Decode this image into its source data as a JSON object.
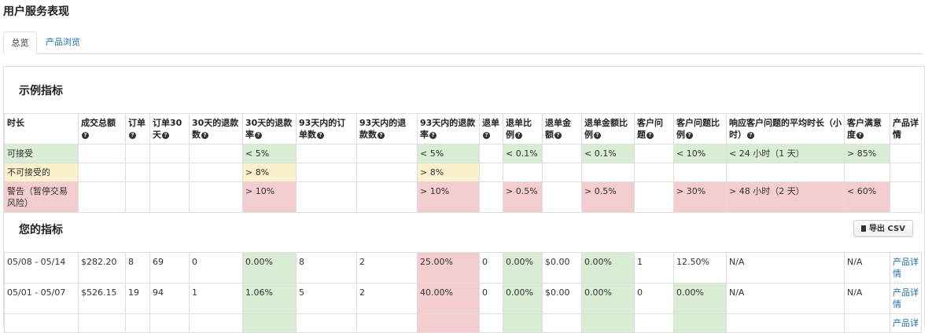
{
  "page_title": "用户服务表现",
  "tabs": [
    {
      "label": "总览",
      "active": true
    },
    {
      "label": "产品浏览",
      "active": false
    }
  ],
  "example_section": {
    "title": "示例指标",
    "columns": [
      {
        "label": "时长",
        "help": false
      },
      {
        "label": "成交总额",
        "help": true
      },
      {
        "label": "订单",
        "help": true
      },
      {
        "label": "订单30天",
        "help": true
      },
      {
        "label": "30天的退款数",
        "help": true
      },
      {
        "label": "30天的退款率",
        "help": true
      },
      {
        "label": "93天内的订单数",
        "help": true
      },
      {
        "label": "93天内的退款数",
        "help": true
      },
      {
        "label": "93天内的退款率",
        "help": true
      },
      {
        "label": "退单",
        "help": true
      },
      {
        "label": "退单比例",
        "help": true
      },
      {
        "label": "退单金额",
        "help": true
      },
      {
        "label": "退单金额比例",
        "help": true
      },
      {
        "label": "客户问题",
        "help": true
      },
      {
        "label": "客户问题比例",
        "help": true
      },
      {
        "label": "响应客户问题的平均时长（小时）",
        "help": true
      },
      {
        "label": "客户满意度",
        "help": true
      },
      {
        "label": "产品详情",
        "help": false
      }
    ],
    "rows": [
      {
        "cells": [
          {
            "t": "可接受",
            "c": "g"
          },
          {
            "t": "",
            "c": ""
          },
          {
            "t": "",
            "c": ""
          },
          {
            "t": "",
            "c": ""
          },
          {
            "t": "",
            "c": ""
          },
          {
            "t": "< 5%",
            "c": "g"
          },
          {
            "t": "",
            "c": ""
          },
          {
            "t": "",
            "c": ""
          },
          {
            "t": "< 5%",
            "c": "g"
          },
          {
            "t": "",
            "c": ""
          },
          {
            "t": "< 0.1%",
            "c": "g"
          },
          {
            "t": "",
            "c": ""
          },
          {
            "t": "< 0.1%",
            "c": "g"
          },
          {
            "t": "",
            "c": ""
          },
          {
            "t": "< 10%",
            "c": "g"
          },
          {
            "t": "< 24 小时（1 天）",
            "c": "g"
          },
          {
            "t": "> 85%",
            "c": "g"
          },
          {
            "t": "",
            "c": ""
          }
        ]
      },
      {
        "cells": [
          {
            "t": "不可接受的",
            "c": "y"
          },
          {
            "t": "",
            "c": ""
          },
          {
            "t": "",
            "c": ""
          },
          {
            "t": "",
            "c": ""
          },
          {
            "t": "",
            "c": ""
          },
          {
            "t": "> 8%",
            "c": "y"
          },
          {
            "t": "",
            "c": ""
          },
          {
            "t": "",
            "c": ""
          },
          {
            "t": "> 8%",
            "c": "y"
          },
          {
            "t": "",
            "c": ""
          },
          {
            "t": "",
            "c": ""
          },
          {
            "t": "",
            "c": ""
          },
          {
            "t": "",
            "c": ""
          },
          {
            "t": "",
            "c": ""
          },
          {
            "t": "",
            "c": ""
          },
          {
            "t": "",
            "c": ""
          },
          {
            "t": "",
            "c": ""
          },
          {
            "t": "",
            "c": ""
          }
        ]
      },
      {
        "cells": [
          {
            "t": "警告（暂停交易风险）",
            "c": "r"
          },
          {
            "t": "",
            "c": ""
          },
          {
            "t": "",
            "c": ""
          },
          {
            "t": "",
            "c": ""
          },
          {
            "t": "",
            "c": ""
          },
          {
            "t": "> 10%",
            "c": "r"
          },
          {
            "t": "",
            "c": ""
          },
          {
            "t": "",
            "c": ""
          },
          {
            "t": "> 10%",
            "c": "r"
          },
          {
            "t": "",
            "c": ""
          },
          {
            "t": "> 0.5%",
            "c": "r"
          },
          {
            "t": "",
            "c": ""
          },
          {
            "t": "> 0.5%",
            "c": "r"
          },
          {
            "t": "",
            "c": ""
          },
          {
            "t": "> 30%",
            "c": "r"
          },
          {
            "t": "> 48 小时（2 天）",
            "c": "r"
          },
          {
            "t": "< 60%",
            "c": "r"
          },
          {
            "t": "",
            "c": ""
          }
        ]
      }
    ]
  },
  "your_section": {
    "title": "您的指标",
    "export_label": "导出 CSV",
    "export_icon": "file-icon",
    "rows": [
      {
        "cells": [
          {
            "t": "05/08 - 05/14",
            "c": ""
          },
          {
            "t": "$282.20",
            "c": ""
          },
          {
            "t": "8",
            "c": ""
          },
          {
            "t": "69",
            "c": ""
          },
          {
            "t": "0",
            "c": ""
          },
          {
            "t": "0.00%",
            "c": "g"
          },
          {
            "t": "8",
            "c": ""
          },
          {
            "t": "2",
            "c": ""
          },
          {
            "t": "25.00%",
            "c": "r"
          },
          {
            "t": "0",
            "c": ""
          },
          {
            "t": "0.00%",
            "c": "g"
          },
          {
            "t": "$0.00",
            "c": ""
          },
          {
            "t": "0.00%",
            "c": "g"
          },
          {
            "t": "1",
            "c": ""
          },
          {
            "t": "12.50%",
            "c": ""
          },
          {
            "t": "N/A",
            "c": ""
          },
          {
            "t": "N/A",
            "c": ""
          },
          {
            "t": "产品详情",
            "c": "",
            "link": true
          }
        ]
      },
      {
        "cells": [
          {
            "t": "05/01 - 05/07",
            "c": ""
          },
          {
            "t": "$526.15",
            "c": ""
          },
          {
            "t": "19",
            "c": ""
          },
          {
            "t": "94",
            "c": ""
          },
          {
            "t": "1",
            "c": ""
          },
          {
            "t": "1.06%",
            "c": "g"
          },
          {
            "t": "5",
            "c": ""
          },
          {
            "t": "2",
            "c": ""
          },
          {
            "t": "40.00%",
            "c": "r"
          },
          {
            "t": "0",
            "c": ""
          },
          {
            "t": "0.00%",
            "c": "g"
          },
          {
            "t": "$0.00",
            "c": ""
          },
          {
            "t": "0.00%",
            "c": "g"
          },
          {
            "t": "0",
            "c": ""
          },
          {
            "t": "0.00%",
            "c": "g"
          },
          {
            "t": "N/A",
            "c": ""
          },
          {
            "t": "N/A",
            "c": ""
          },
          {
            "t": "产品详情",
            "c": "",
            "link": true
          }
        ]
      },
      {
        "cells": [
          {
            "t": "",
            "c": ""
          },
          {
            "t": "",
            "c": ""
          },
          {
            "t": "",
            "c": ""
          },
          {
            "t": "",
            "c": ""
          },
          {
            "t": "",
            "c": ""
          },
          {
            "t": "",
            "c": "g"
          },
          {
            "t": "",
            "c": ""
          },
          {
            "t": "",
            "c": ""
          },
          {
            "t": "",
            "c": "r"
          },
          {
            "t": "",
            "c": ""
          },
          {
            "t": "",
            "c": "g"
          },
          {
            "t": "",
            "c": ""
          },
          {
            "t": "",
            "c": "g"
          },
          {
            "t": "",
            "c": ""
          },
          {
            "t": "",
            "c": "g"
          },
          {
            "t": "",
            "c": ""
          },
          {
            "t": "",
            "c": ""
          },
          {
            "t": "产品详",
            "c": "",
            "link": true
          }
        ]
      }
    ]
  },
  "colors": {
    "ok": "#d9ecd4",
    "warn": "#fbf1cc",
    "bad": "#f4cdd0",
    "link": "#1a6fb0"
  }
}
